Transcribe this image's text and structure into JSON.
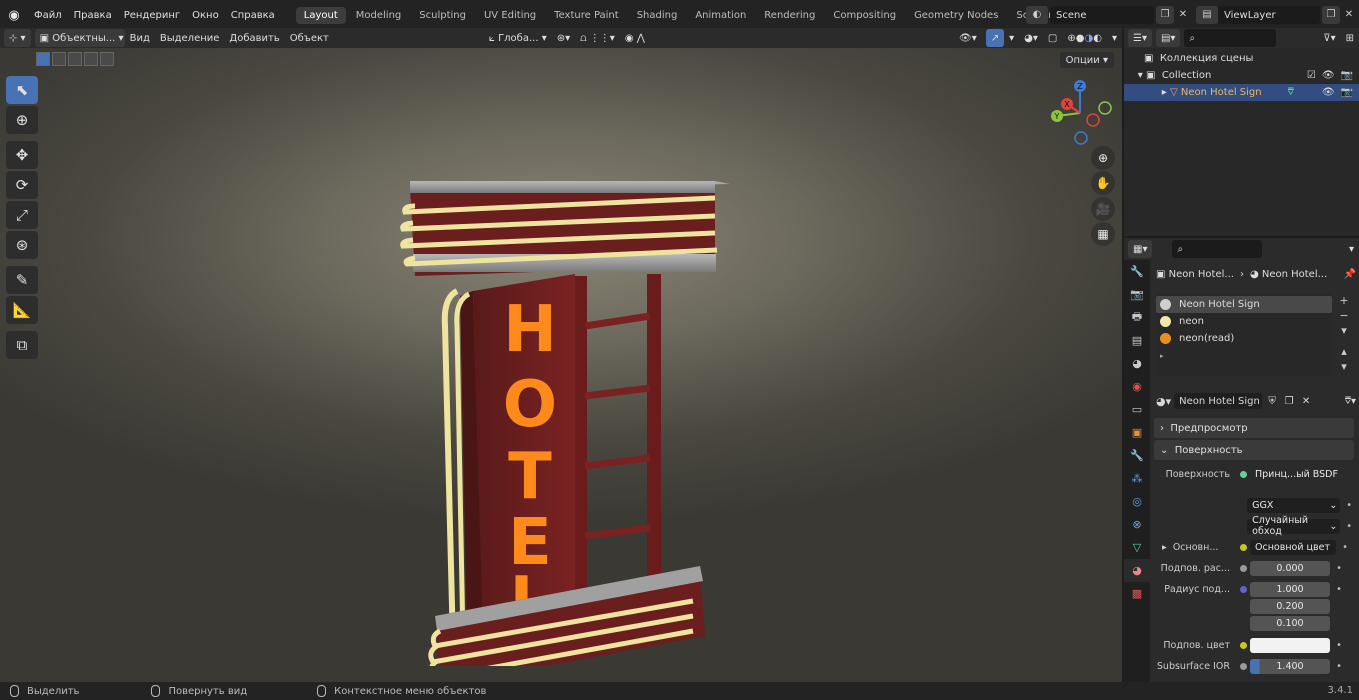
{
  "topbar": {
    "menus": [
      "Файл",
      "Правка",
      "Рендеринг",
      "Окно",
      "Справка"
    ],
    "workspaces": [
      "Layout",
      "Modeling",
      "Sculpting",
      "UV Editing",
      "Texture Paint",
      "Shading",
      "Animation",
      "Rendering",
      "Compositing",
      "Geometry Nodes",
      "Scripting"
    ],
    "active_workspace": "Layout",
    "scene": "Scene",
    "view_layer": "ViewLayer"
  },
  "viewport_header": {
    "mode": "Объектны...",
    "menus": [
      "Вид",
      "Выделение",
      "Добавить",
      "Объект"
    ],
    "transform": "Глоба...",
    "options": "Опции"
  },
  "outliner": {
    "scene_collection": "Коллекция сцены",
    "collection": "Collection",
    "object": "Neon Hotel Sign"
  },
  "properties": {
    "breadcrumb_object": "Neon Hotel...",
    "breadcrumb_material": "Neon Hotel...",
    "slots": [
      {
        "name": "Neon Hotel Sign",
        "color": "#cfcfcf"
      },
      {
        "name": "neon",
        "color": "#f1e9a8"
      },
      {
        "name": "neon(read)",
        "color": "#e8901c"
      }
    ],
    "material_name": "Neon Hotel Sign",
    "preview": "Предпросмотр",
    "surface_panel": "Поверхность",
    "surface_label": "Поверхность",
    "surface_value": "Принц...ый BSDF",
    "distribution": "GGX",
    "subsurface_method": "Случайный обход",
    "base_label": "Основн...",
    "base_value": "Основной цвет",
    "subsurface_label": "Подпов. рас...",
    "subsurface_value": "0.000",
    "radius_label": "Радиус под...",
    "radius_values": [
      "1.000",
      "0.200",
      "0.100"
    ],
    "subsurface_color_label": "Подпов. цвет",
    "ior_label": "Subsurface IOR",
    "ior_value": "1.400"
  },
  "statusbar": {
    "select": "Выделить",
    "rotate": "Повернуть вид",
    "context": "Контекстное меню объектов",
    "version": "3.4.1"
  },
  "sign_letters": [
    "H",
    "O",
    "T",
    "E",
    "L"
  ]
}
